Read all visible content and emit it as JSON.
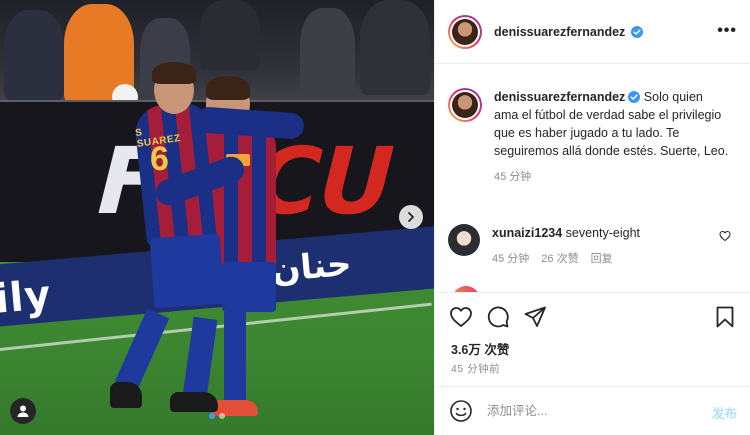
{
  "post": {
    "board_text_left": "FS",
    "board_text_right": "CU",
    "ad_text": "ily",
    "ad_arabic": "حنان",
    "jersey_name": "S SUAREZ",
    "jersey_number": "6",
    "carousel_total": 2,
    "carousel_index": 1
  },
  "header": {
    "username": "denissuarezfernandez",
    "more_label": "•••"
  },
  "caption": {
    "username": "denissuarezfernandez",
    "text": "Solo quien ama el fútbol de verdad sabe el privilegio que es haber jugado a tu lado. Te seguiremos allá donde estés. Suerte, Leo.",
    "time": "45 分钟"
  },
  "comments": [
    {
      "username": "xunaizi1234",
      "text": "seventy-eight",
      "time": "45 分钟",
      "likes": "26 次赞",
      "reply": "回复"
    }
  ],
  "actions": {
    "likes": "3.6万 次赞",
    "time": "45 分钟前"
  },
  "composer": {
    "placeholder": "添加评论...",
    "post_label": "发布"
  },
  "colors": {
    "accent": "#3d9df6",
    "verified": "#3897f0",
    "post_disabled": "#b2dffc",
    "muted": "#8e8e8e"
  },
  "icons": [
    "heart-icon",
    "comment-icon",
    "share-icon",
    "bookmark-icon",
    "emoji-icon",
    "verified-icon",
    "chevron-right-icon",
    "user-tag-icon",
    "more-icon"
  ]
}
